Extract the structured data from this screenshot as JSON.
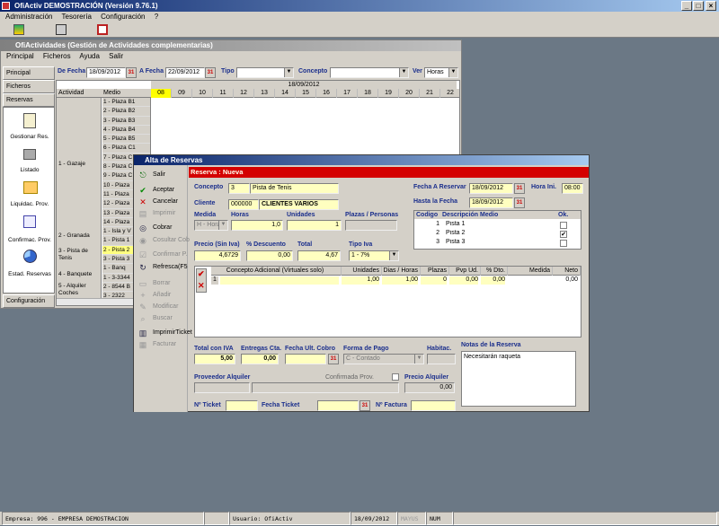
{
  "app": {
    "title": "OfiActiv DEMOSTRACIÓN (Versión 9.76.1)",
    "menu": [
      "Administración",
      "Tesorería",
      "Configuración",
      "?"
    ]
  },
  "sub": {
    "title": "OfiActividades (Gestión de Actividades complementarias)",
    "menu": [
      "Principal",
      "Ficheros",
      "Ayuda",
      "Salir"
    ]
  },
  "side": {
    "principal": "Principal",
    "ficheros": "Ficheros",
    "reservas": "Reservas",
    "items": [
      "Gestionar Res.",
      "Listado",
      "Liquidac. Prov.",
      "Confirmac. Prov.",
      "Estad. Reservas"
    ],
    "config": "Configuración"
  },
  "filter": {
    "de_fecha_label": "De Fecha",
    "de_fecha": "18/09/2012",
    "a_fecha_label": "A Fecha",
    "a_fecha": "22/09/2012",
    "tipo_label": "Tipo",
    "concepto_label": "Concepto",
    "ver_label": "Ver",
    "ver_value": "Horas"
  },
  "grid": {
    "date": "18/09/2012",
    "col_actividad": "Actividad",
    "col_medio": "Medio",
    "hours": [
      "08",
      "09",
      "10",
      "11",
      "12",
      "13",
      "14",
      "15",
      "16",
      "17",
      "18",
      "19",
      "20",
      "21",
      "22"
    ],
    "activities": [
      {
        "name": "1 - Gazaje"
      },
      {
        "name": "2 - Granada"
      },
      {
        "name": "3 - Pista de Tenis"
      },
      {
        "name": "4 - Banquete"
      },
      {
        "name": "5 - Alquiler Coches"
      }
    ],
    "medios": [
      "1 - Plaza B1",
      "2 - Plaza B2",
      "3 - Plaza B3",
      "4 - Plaza B4",
      "5 - Plaza B5",
      "6 - Plaza C1",
      "7 - Plaza C",
      "8 - Plaza C",
      "9 - Plaza C",
      "10 - Plaza",
      "11 - Plaza",
      "12 - Plaza",
      "13 - Plaza",
      "14 - Plaza",
      "1 - Isla y V",
      "1 - Pista 1",
      "2 - Pista 2",
      "3 - Pista 3",
      "1 - Banq",
      "1 - 3-3344",
      "2 - 8544 B",
      "3 - 2322"
    ]
  },
  "dialog": {
    "title": "Alta de Reservas",
    "banner": "Reserva : Nueva",
    "tools": [
      {
        "label": "Salir",
        "icon": "exit-icon",
        "enabled": true
      },
      {
        "label": "Aceptar",
        "icon": "check-icon",
        "enabled": true
      },
      {
        "label": "Cancelar",
        "icon": "cross-icon",
        "enabled": true
      },
      {
        "label": "Imprimir",
        "icon": "printer-icon",
        "enabled": false
      },
      {
        "label": "Cobrar",
        "icon": "coins-icon",
        "enabled": true
      },
      {
        "label": "Cosultar Cob",
        "icon": "search-money-icon",
        "enabled": false
      },
      {
        "label": "Confirmar P.",
        "icon": "confirm-icon",
        "enabled": false
      },
      {
        "label": "Refresca(F5",
        "icon": "refresh-icon",
        "enabled": true
      },
      {
        "label": "Borrar",
        "icon": "delete-icon",
        "enabled": false
      },
      {
        "label": "Añadir",
        "icon": "add-icon",
        "enabled": false
      },
      {
        "label": "Modificar",
        "icon": "edit-icon",
        "enabled": false
      },
      {
        "label": "Buscar",
        "icon": "search-icon",
        "enabled": false
      },
      {
        "label": "ImprimirTicket",
        "icon": "ticket-icon",
        "enabled": true
      },
      {
        "label": "Facturar",
        "icon": "invoice-icon",
        "enabled": false
      }
    ],
    "concepto_label": "Concepto",
    "concepto_code": "3",
    "concepto_name": "Pista de Tenis",
    "cliente_label": "Cliente",
    "cliente_code": "000000",
    "cliente_name": "CLIENTES VARIOS",
    "medida_label": "Medida",
    "medida_value": "H - Hora",
    "horas_label": "Horas",
    "horas_value": "1,0",
    "unidades_label": "Unidades",
    "unidades_value": "1",
    "plazas_label": "Plazas / Personas",
    "precio_label": "Precio (Sin Iva)",
    "precio_value": "4,6729",
    "descuento_label": "% Descuento",
    "descuento_value": "0,00",
    "total_label": "Total",
    "total_value": "4,67",
    "tipo_iva_label": "Tipo Iva",
    "tipo_iva_value": "1 - 7%",
    "fecha_reservar_label": "Fecha A Reservar",
    "fecha_reservar": "18/09/2012",
    "hora_ini_label": "Hora Ini.",
    "hora_ini": "08:00",
    "hasta_label": "Hasta la Fecha",
    "hasta": "18/09/2012",
    "medios_headers": [
      "Codigo",
      "Descripción Medio",
      "Ok."
    ],
    "medios": [
      {
        "code": "1",
        "desc": "Pista 1",
        "ok": false
      },
      {
        "code": "2",
        "desc": "Pista 2",
        "ok": true
      },
      {
        "code": "3",
        "desc": "Pista 3",
        "ok": false
      }
    ],
    "lines_headers": [
      "Concepto Adicional  (Virtuales solo)",
      "Unidades",
      "Dias / Horas",
      "Plazas",
      "Pvp Ud.",
      "% Dto.",
      "Medida",
      "Neto"
    ],
    "lines": [
      {
        "n": "1",
        "concepto": "",
        "unidades": "1,00",
        "dias": "1,00",
        "plazas": "0",
        "pvp": "0,00",
        "dto": "0,00",
        "medida": "",
        "neto": "0,00"
      }
    ],
    "total_iva_label": "Total con IVA",
    "total_iva": "5,00",
    "entregas_label": "Entregas Cta.",
    "entregas": "0,00",
    "fecha_cobro_label": "Fecha Ult. Cobro",
    "forma_pago_label": "Forma de Pago",
    "forma_pago": "C - Contado",
    "habitac_label": "Habitac.",
    "notas_label": "Notas de la Reserva",
    "notas": "Necesitarán raqueta",
    "proveedor_label": "Proveedor Alquiler",
    "confirmada_label": "Confirmada Prov.",
    "precio_alq_label": "Precio Alquiler",
    "precio_alq": "0,00",
    "ticket_label": "Nº Ticket",
    "fecha_ticket_label": "Fecha Ticket",
    "factura_label": "Nº Factura"
  },
  "status": {
    "empresa": "Empresa: 996 - EMPRESA DEMOSTRACION",
    "usuario": "Usuario: OfiActiv",
    "fecha": "18/09/2012",
    "mayus": "MAYUS",
    "num": "NUM"
  },
  "colors": {
    "title_start": "#0a246a",
    "banner": "#d40000",
    "yellow": "#ffffc0",
    "highlight_hour": "#ffff00"
  }
}
